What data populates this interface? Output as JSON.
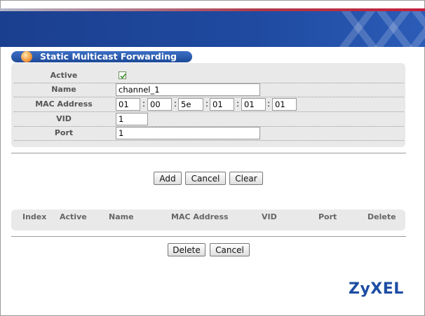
{
  "section": {
    "title": "Static Multicast Forwarding"
  },
  "form": {
    "active_label": "Active",
    "active_checked": true,
    "name_label": "Name",
    "name_value": "channel_1",
    "mac_label": "MAC Address",
    "mac_octets": [
      "01",
      "00",
      "5e",
      "01",
      "01",
      "01"
    ],
    "mac_separator": ":",
    "vid_label": "VID",
    "vid_value": "1",
    "port_label": "Port",
    "port_value": "1"
  },
  "actions": {
    "add": "Add",
    "cancel": "Cancel",
    "clear": "Clear"
  },
  "table": {
    "columns": [
      "Index",
      "Active",
      "Name",
      "MAC Address",
      "VID",
      "Port",
      "Delete"
    ]
  },
  "table_actions": {
    "delete": "Delete",
    "cancel": "Cancel"
  },
  "brand": {
    "logo_text": "ZyXEL",
    "logo_color": "#1d4da3",
    "banner_color": "#1f4aa0"
  }
}
